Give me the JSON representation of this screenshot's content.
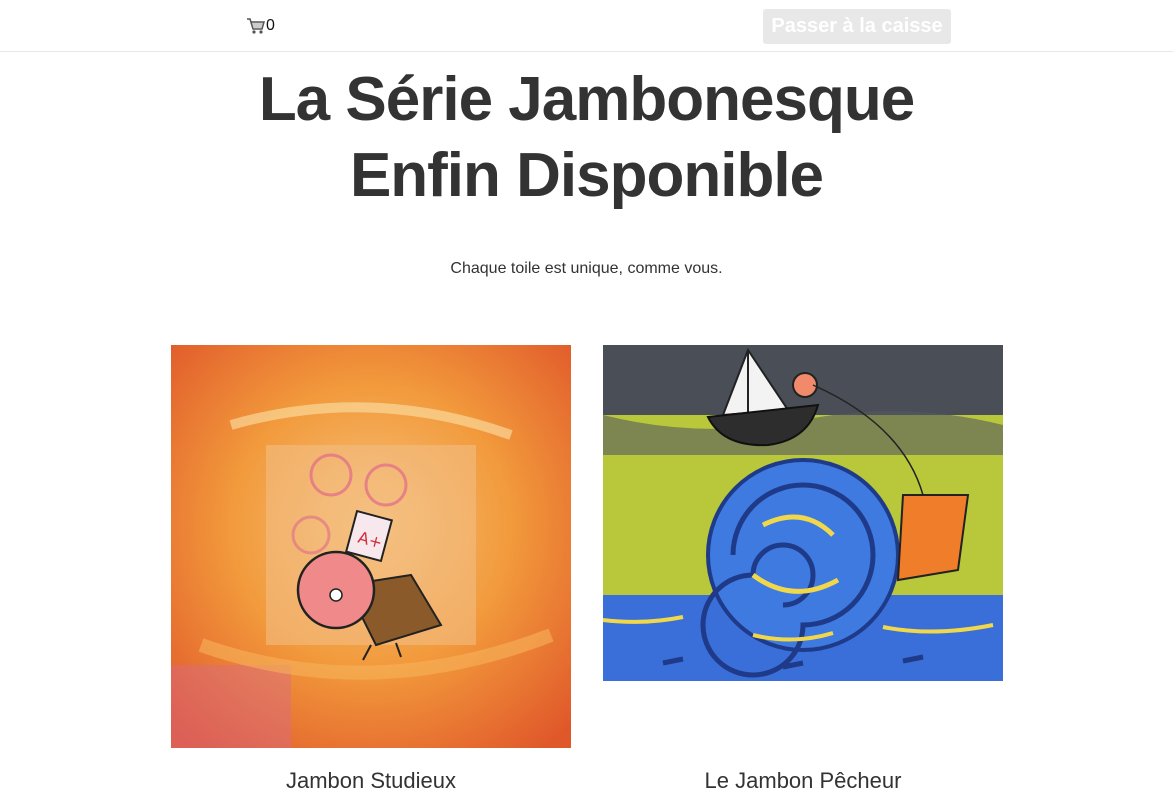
{
  "header": {
    "cart_icon": "shopping-cart-icon",
    "cart_count": "0",
    "checkout_label": "Passer à la caisse"
  },
  "hero": {
    "title": "La Série Jambonesque Enfin Disponible",
    "subtitle": "Chaque toile est unique, comme vous."
  },
  "products": [
    {
      "title": "Jambon Studieux",
      "image_label": "A+"
    },
    {
      "title": "Le Jambon Pêcheur"
    }
  ],
  "colors": {
    "text": "#333333",
    "checkout_bg": "#e8e8e8"
  }
}
